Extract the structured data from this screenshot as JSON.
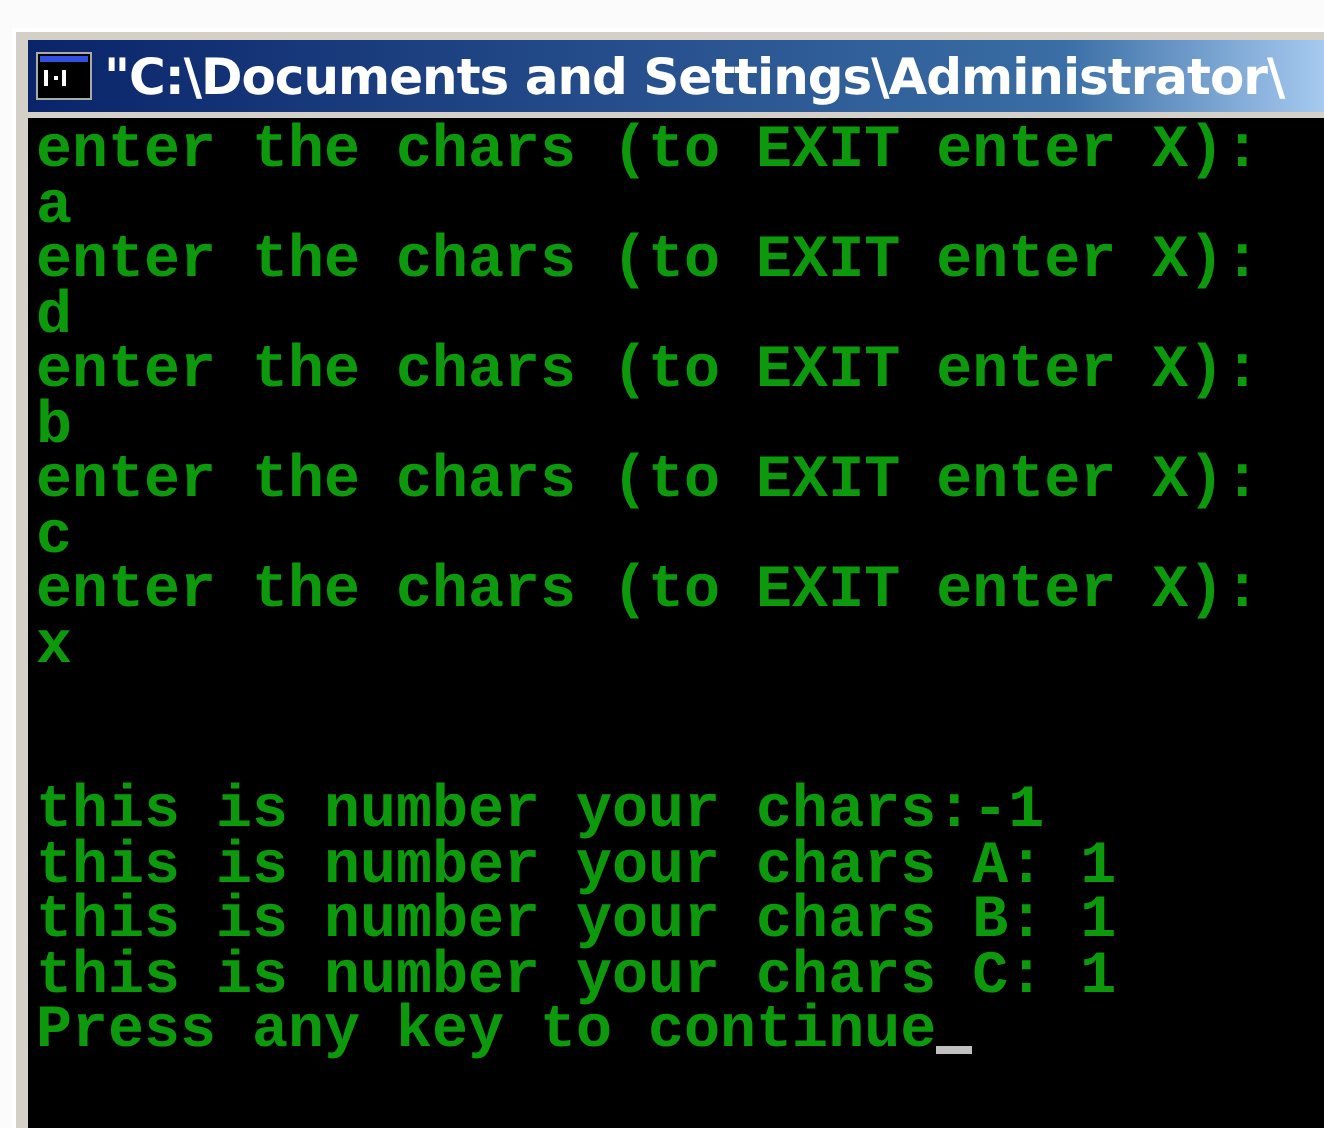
{
  "window": {
    "title": "\"C:\\Documents and Settings\\Administrator\\"
  },
  "console": {
    "sections": [
      {
        "lines": [
          "enter the chars (to EXIT enter X):",
          "a",
          "enter the chars (to EXIT enter X):",
          "d",
          "enter the chars (to EXIT enter X):",
          "b",
          "enter the chars (to EXIT enter X):",
          "c",
          "enter the chars (to EXIT enter X):",
          "x"
        ]
      },
      {
        "lines": [
          "this is number your chars:-1",
          "this is number your chars A: 1",
          "this is number your chars B: 1",
          "this is number your chars C: 1",
          "Press any key to continue"
        ]
      }
    ],
    "cursor": true
  }
}
